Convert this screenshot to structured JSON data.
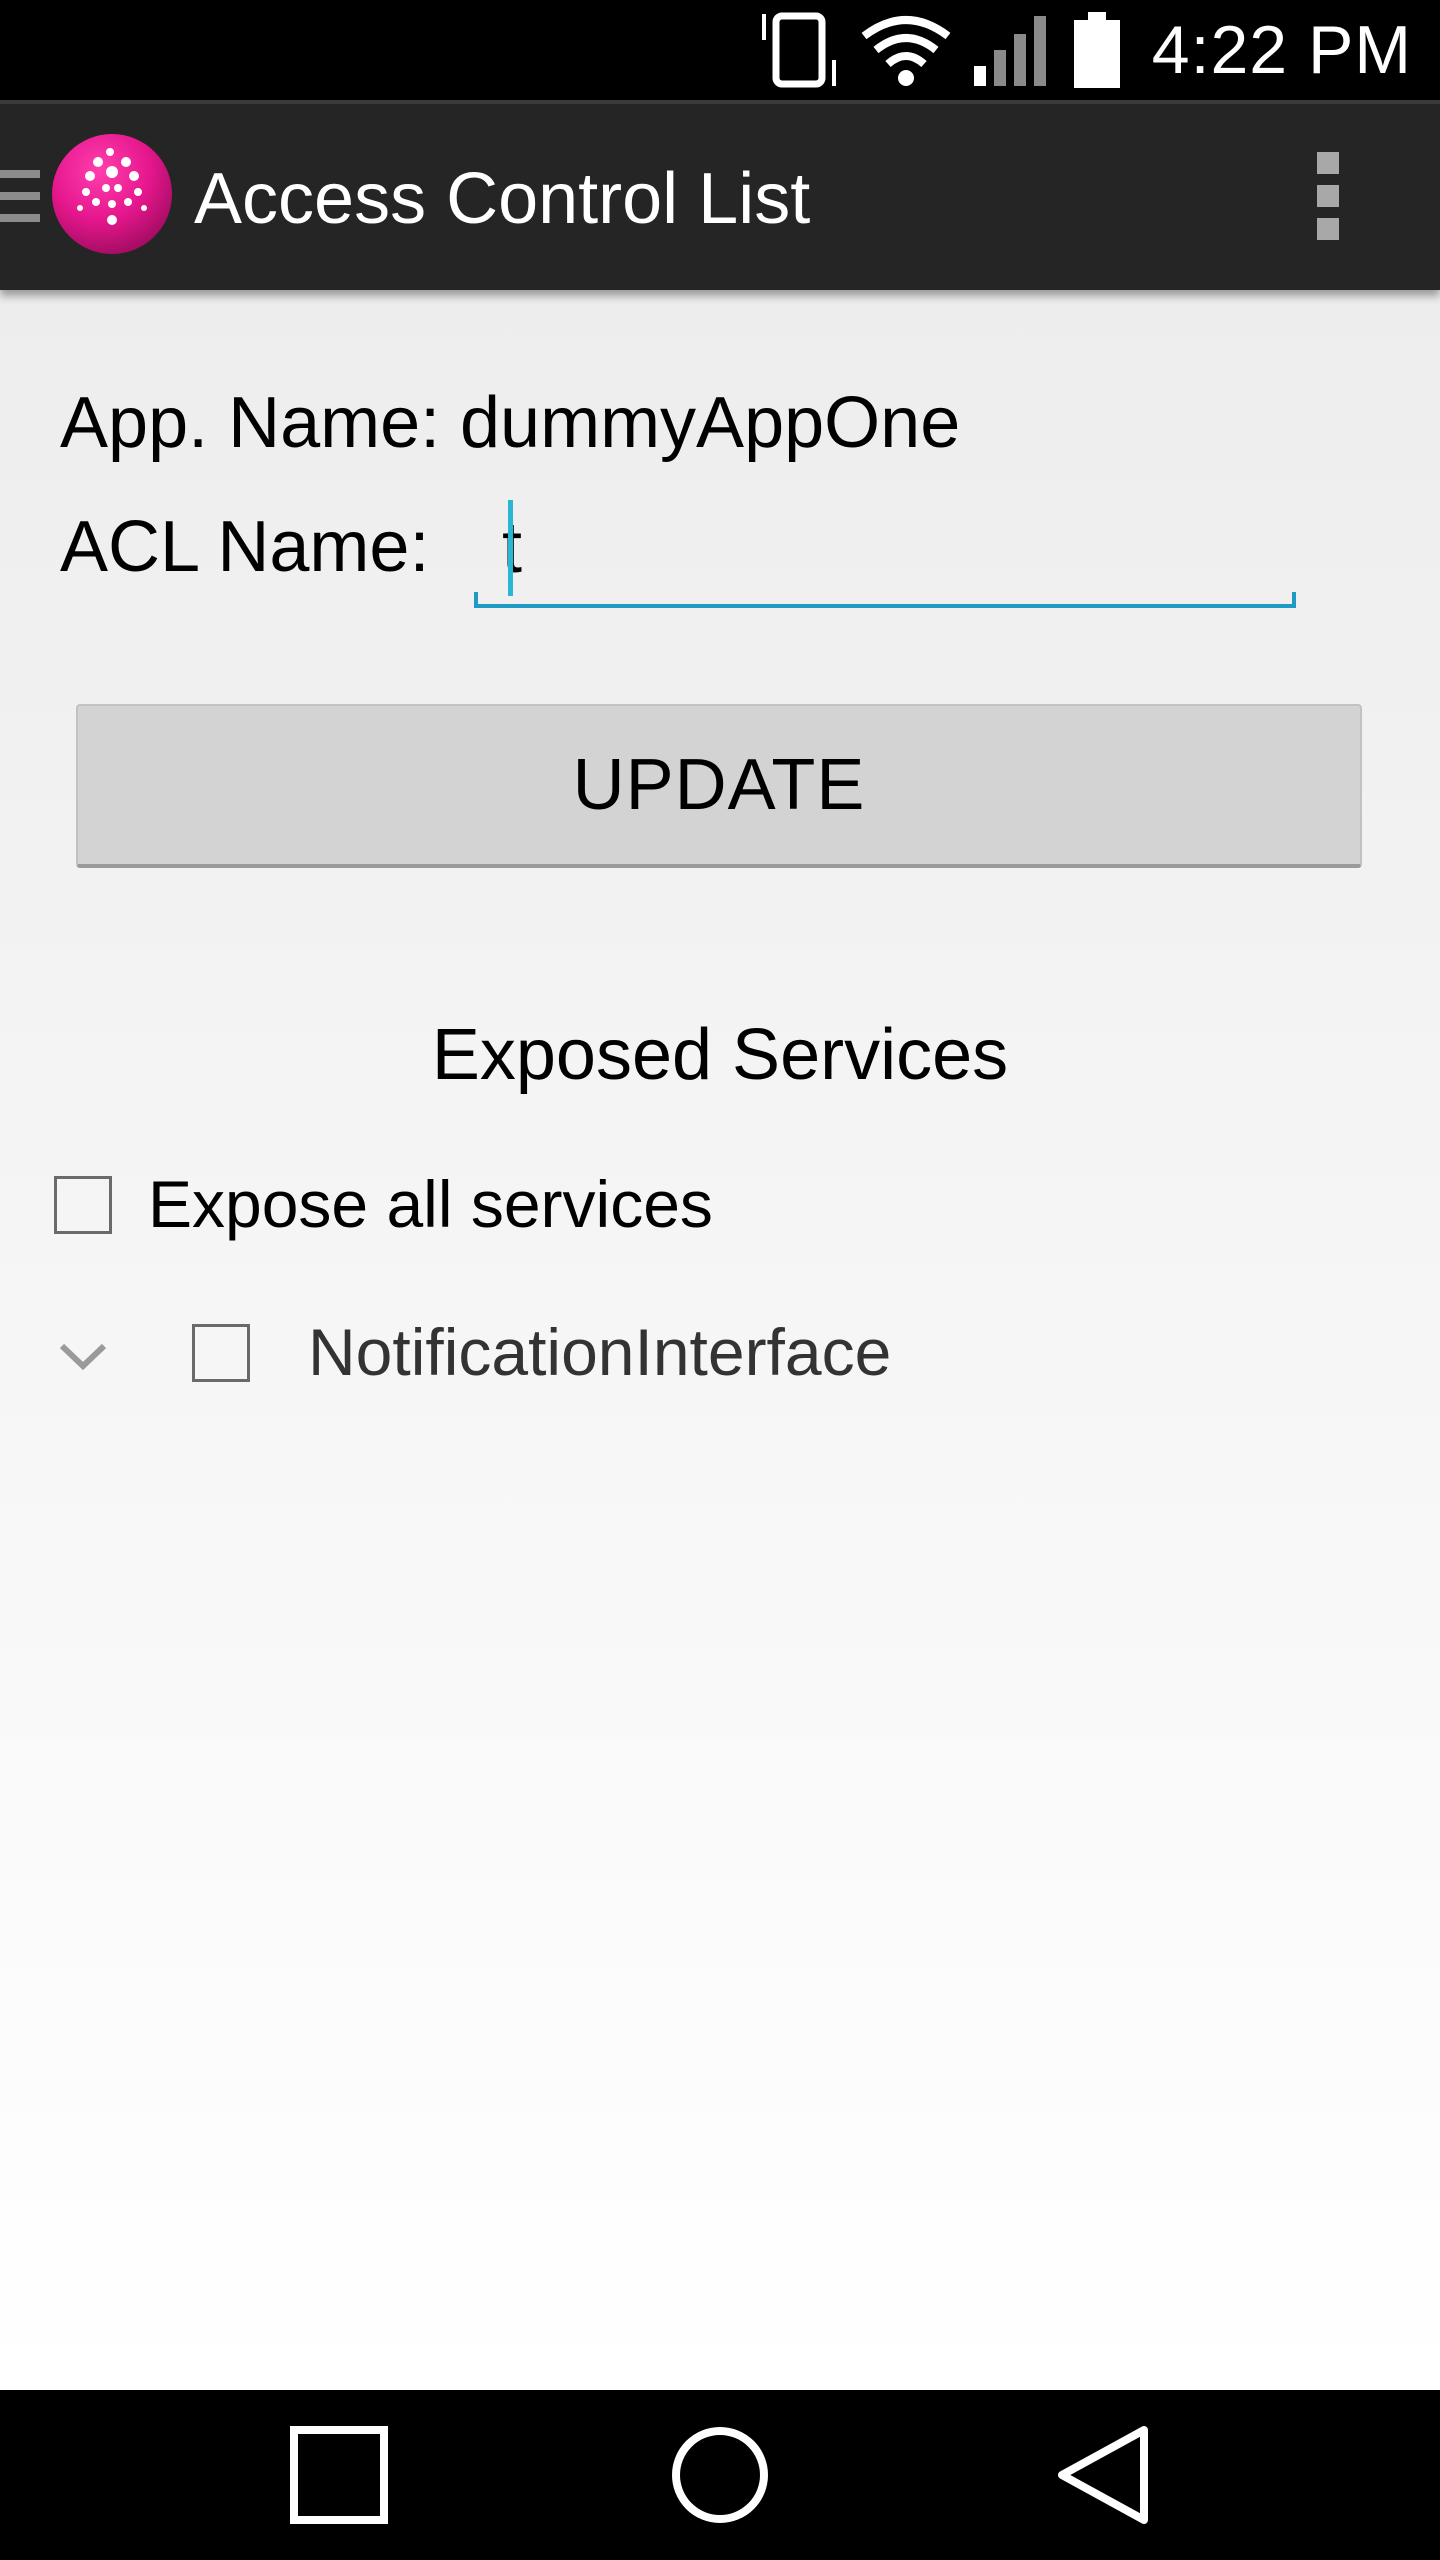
{
  "status_bar": {
    "time": "4:22 PM",
    "icons": [
      "vibrate-icon",
      "wifi-icon",
      "signal-icon",
      "battery-icon"
    ]
  },
  "app_bar": {
    "title": "Access Control List",
    "drawer_icon": "drawer-icon",
    "logo_icon": "app-logo-icon",
    "overflow_icon": "overflow-menu-icon"
  },
  "form": {
    "app_name_label": "App. Name:",
    "app_name_value": "dummyAppOne",
    "acl_name_label": "ACL Name:",
    "acl_name_value": "t",
    "update_button": "UPDATE"
  },
  "services": {
    "title": "Exposed Services",
    "expose_all_label": "Expose all services",
    "expose_all_checked": false,
    "items": [
      {
        "label": "NotificationInterface",
        "checked": false,
        "expand_icon": "chevron-down-icon"
      }
    ]
  },
  "nav_bar": {
    "buttons": [
      "recents-icon",
      "home-icon",
      "back-icon"
    ]
  },
  "colors": {
    "accent": "#1e9ac4",
    "app_bar": "#252525",
    "logo": "#e5168c"
  }
}
